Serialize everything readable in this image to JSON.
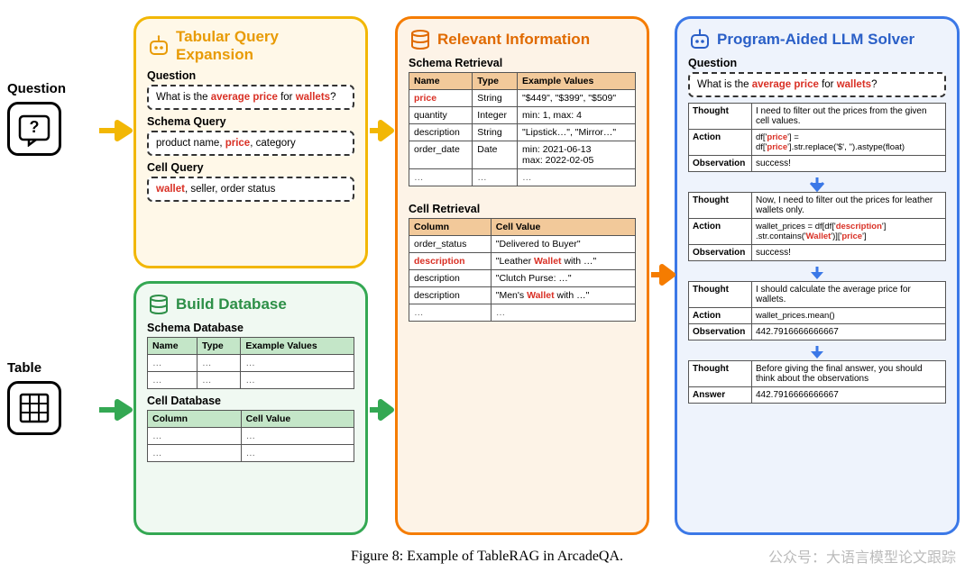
{
  "left": {
    "question_label": "Question",
    "table_label": "Table"
  },
  "panel1": {
    "title": "Tabular Query Expansion",
    "question_label": "Question",
    "question_pre": "What is the ",
    "question_hl1": "average price",
    "question_mid": " for ",
    "question_hl2": "wallets",
    "question_post": "?",
    "schema_label": "Schema Query",
    "schema_pre": "product name, ",
    "schema_hl": "price",
    "schema_post": ", category",
    "cell_label": "Cell Query",
    "cell_hl": "wallet",
    "cell_post": ", seller, order status"
  },
  "panel2": {
    "title": "Build Database",
    "schema_label": "Schema Database",
    "cell_label": "Cell Database",
    "h_name": "Name",
    "h_type": "Type",
    "h_ex": "Example Values",
    "h_col": "Column",
    "h_val": "Cell Value",
    "el": "…"
  },
  "panel3": {
    "title": "Relevant Information",
    "schema_label": "Schema Retrieval",
    "h_name": "Name",
    "h_type": "Type",
    "h_ex": "Example Values",
    "s1_name": "price",
    "s1_type": "String",
    "s1_ex": "\"$449\", \"$399\", \"$509\"",
    "s2_name": "quantity",
    "s2_type": "Integer",
    "s2_ex": "min: 1, max: 4",
    "s3_name": "description",
    "s3_type": "String",
    "s3_ex": "\"Lipstick…\", \"Mirror…\"",
    "s4_name": "order_date",
    "s4_type": "Date",
    "s4_ex": "min: 2021-06-13\nmax: 2022-02-05",
    "el": "…",
    "cell_label": "Cell Retrieval",
    "h_col": "Column",
    "h_val": "Cell Value",
    "c1_col": "order_status",
    "c1_val": "\"Delivered to Buyer\"",
    "c2_col": "description",
    "c2_val_pre": "\"Leather ",
    "c2_val_hl": "Wallet",
    "c2_val_post": " with …\"",
    "c3_col": "description",
    "c3_val": "\"Clutch Purse: …\"",
    "c4_col": "description",
    "c4_val_pre": "\"Men's ",
    "c4_val_hl": "Wallet",
    "c4_val_post": " with …\""
  },
  "panel4": {
    "title": "Program-Aided LLM Solver",
    "question_label": "Question",
    "thought": "Thought",
    "action": "Action",
    "obs": "Observation",
    "answer": "Answer",
    "step1_t": "I need to filter out the prices from the given cell values.",
    "step1_a_pre": "df['",
    "step1_a_h1": "price",
    "step1_a_mid1": "'] =\ndf['",
    "step1_a_h2": "price",
    "step1_a_mid2": "'].str.replace('$', '').astype(float)",
    "step1_o": "success!",
    "step2_t": "Now, I need to filter out the prices for leather wallets only.",
    "step2_a_pre": "wallet_prices = df[df['",
    "step2_a_h1": "description",
    "step2_a_mid1": "']\n.str.contains('",
    "step2_a_h2": "Wallet",
    "step2_a_mid2": "')]['",
    "step2_a_h3": "price",
    "step2_a_post": "']",
    "step2_o": "success!",
    "step3_t": "I should calculate the average price for wallets.",
    "step3_a": "wallet_prices.mean()",
    "step3_o": "442.7916666666667",
    "step4_t": "Before giving the final answer, you should think about the observations",
    "step4_ans": "442.7916666666667"
  },
  "caption": "Figure 8: Example of TableRAG in ArcadeQA.",
  "watermark": "公众号：大语言模型论文跟踪"
}
